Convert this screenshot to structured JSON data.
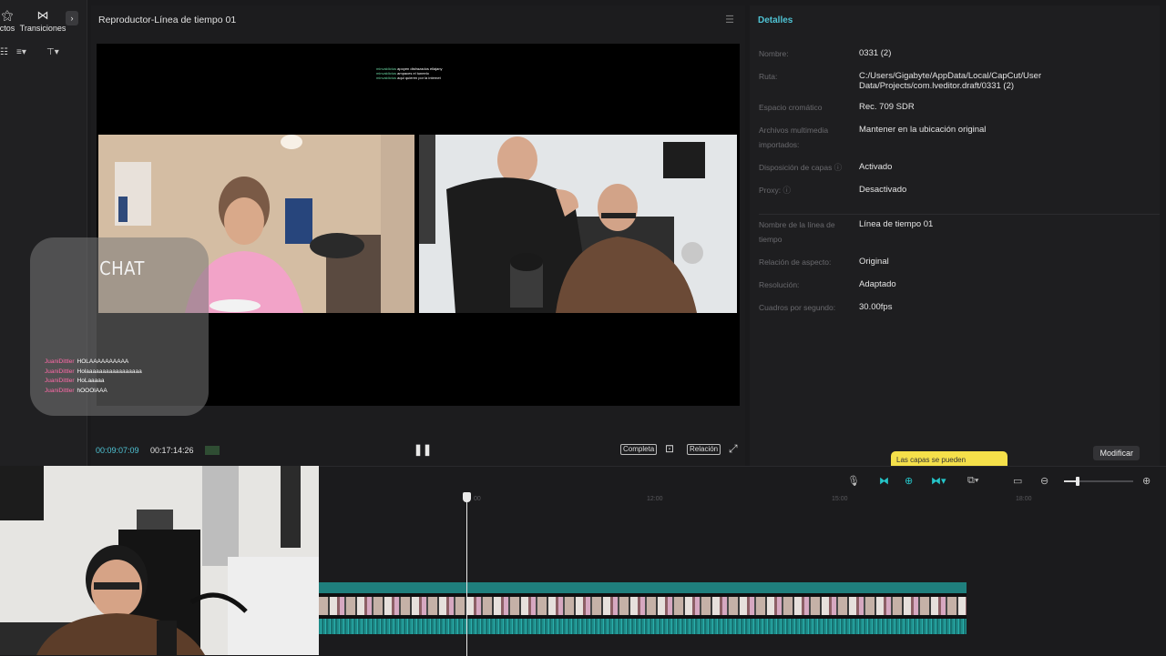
{
  "left_panel": {
    "tabs": [
      {
        "label": "ctos",
        "icon": "effects-icon"
      },
      {
        "label": "Transiciones",
        "icon": "transitions-icon"
      }
    ]
  },
  "player": {
    "title": "Reproductor-Línea de tiempo 01",
    "current_time": "00:09:07:09",
    "total_time": "00:17:14:26",
    "buttons": {
      "full": "Completa",
      "ratio": "Relación"
    },
    "stream_chat_lines": [
      {
        "user": "minvaldictus",
        "text": "apoyen disfrazados ellajany"
      },
      {
        "user": "minvaldictus",
        "text": "ampaces el tuneelo"
      },
      {
        "user": "minvaldictus",
        "text": "aqui quieren por la internet"
      }
    ],
    "chat_widget": {
      "title": "CHAT",
      "messages": [
        {
          "user": "JuaniDittler",
          "text": "HOLAAAAAAAAAA"
        },
        {
          "user": "JuaniDittler",
          "text": "Holaaaaaaaaaaaaaaaaa"
        },
        {
          "user": "JuaniDittler",
          "text": "HoLaaaaa"
        },
        {
          "user": "JuaniDittler",
          "text": "hOOOlAAA"
        }
      ]
    }
  },
  "details": {
    "title": "Detalles",
    "rows": [
      {
        "key": "Nombre:",
        "value": "0331 (2)"
      },
      {
        "key": "Ruta:",
        "value": "C:/Users/Gigabyte/AppData/Local/CapCut/User Data/Projects/com.lveditor.draft/0331 (2)"
      },
      {
        "key": "Espacio cromático",
        "value": "Rec. 709 SDR"
      },
      {
        "key": "Archivos multimedia importados:",
        "value": "Mantener en la ubicación original"
      },
      {
        "key": "Disposición de capas ⓘ",
        "value": "Activado"
      },
      {
        "key": "Proxy: ⓘ",
        "value": "Desactivado"
      },
      {
        "key": "Nombre de la línea de tiempo",
        "value": "Línea de tiempo 01"
      },
      {
        "key": "Relación de aspecto:",
        "value": "Original"
      },
      {
        "key": "Resolución:",
        "value": "Adaptado"
      },
      {
        "key": "Cuadros por segundo:",
        "value": "30.00fps"
      }
    ],
    "modify_label": "Modificar",
    "tooltip": "Las capas se pueden"
  },
  "timeline": {
    "ticks": [
      "00",
      "12:00",
      "15:00",
      "18:00"
    ],
    "zoom_level": 0.2
  }
}
